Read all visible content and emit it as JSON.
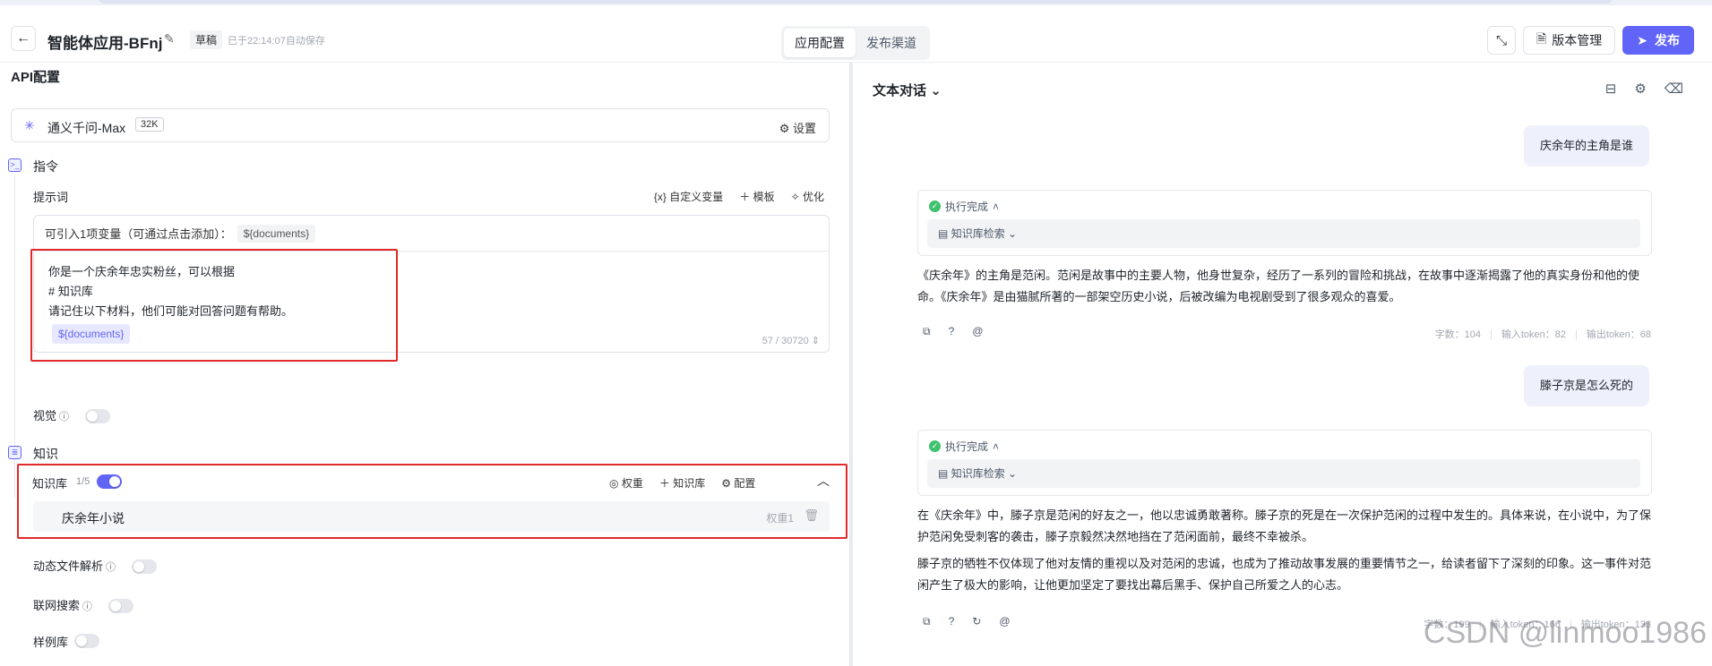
{
  "header": {
    "back_icon": "arrow-left-icon",
    "app_title": "智能体应用-BFnj",
    "draft_label": "草稿",
    "autosave_text": "已于22:14:07自动保存",
    "tabs": [
      {
        "label": "应用配置",
        "active": true
      },
      {
        "label": "发布渠道",
        "active": false
      }
    ],
    "version_label": "版本管理",
    "publish_label": "发布",
    "accent_color": "#6165f7"
  },
  "left": {
    "api_title": "API配置",
    "model_name": "通义千问-Max",
    "model_context": "32K",
    "model_settings": "设置",
    "instruction_title": "指令",
    "prompt_label": "提示词",
    "prompt_tools": [
      "自定义变量",
      "模板",
      "优化"
    ],
    "var_hint": "可引入1项变量（可通过点击添加）：",
    "var_chip": "${documents}",
    "prompt_lines": [
      "你是一个庆余年忠实粉丝，可以根据",
      "# 知识库",
      "请记住以下材料，他们可能对回答问题有帮助。"
    ],
    "prompt_var": "${documents}",
    "counter": "57 / 30720",
    "vision_label": "视觉",
    "knowledge_title": "知识",
    "kb_label": "知识库",
    "kb_count": "1/5",
    "kb_tools": [
      "权重",
      "知识库",
      "配置"
    ],
    "kb_item_name": "庆余年小说",
    "kb_item_weight": "权重1",
    "dynamic_parse_label": "动态文件解析",
    "web_search_label": "联网搜索",
    "examples_label": "样例库"
  },
  "right": {
    "chat_mode": "文本对话",
    "messages": [
      {
        "question": "庆余年的主角是谁",
        "status": "执行完成",
        "search_label": "知识库检索",
        "answer": [
          "《庆余年》的主角是范闲。范闲是故事中的主要人物，他身世复杂，经历了一系列的冒险和挑战，在故事中逐渐揭露了他的真实身份和他的使命。《庆余年》是由猫腻所著的一部架空历史小说，后被改编为电视剧受到了很多观众的喜爱。"
        ],
        "chars": "字数：104",
        "input_tokens": "输入token：82",
        "output_tokens": "输出token：68"
      },
      {
        "question": "滕子京是怎么死的",
        "status": "执行完成",
        "search_label": "知识库检索",
        "answer": [
          "在《庆余年》中，滕子京是范闲的好友之一，他以忠诚勇敢著称。滕子京的死是在一次保护范闲的过程中发生的。具体来说，在小说中，为了保护范闲免受刺客的袭击，滕子京毅然决然地挡在了范闲面前，最终不幸被杀。",
          "滕子京的牺牲不仅体现了他对友情的重视以及对范闲的忠诚，也成为了推动故事发展的重要情节之一，给读者留下了深刻的印象。这一事件对范闲产生了极大的影响，让他更加坚定了要找出幕后黑手、保护自己所爱之人的心志。"
        ],
        "chars": "字数：199",
        "input_tokens": "输入token：166",
        "output_tokens": "输出token：133"
      }
    ]
  },
  "watermark": "CSDN @linmoo1986"
}
